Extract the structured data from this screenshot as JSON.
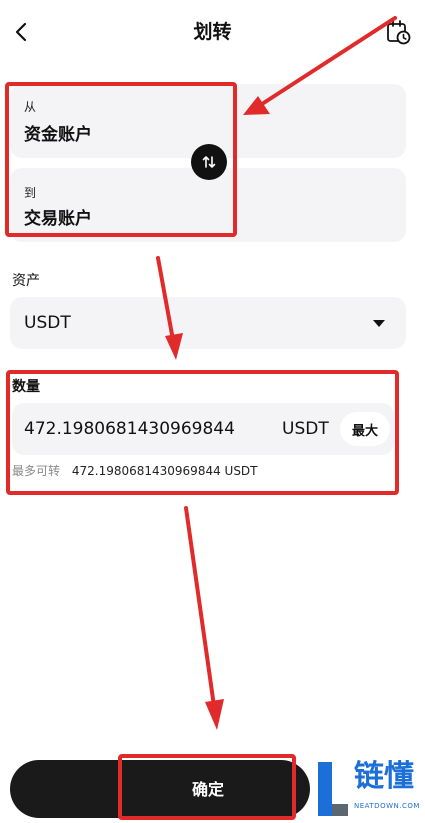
{
  "header": {
    "title": "划转",
    "back_icon": "chevron-left-icon",
    "history_icon": "calendar-clock-icon"
  },
  "from": {
    "label": "从",
    "value": "资金账户"
  },
  "to": {
    "label": "到",
    "value": "交易账户"
  },
  "swap_icon": "swap-arrows-icon",
  "asset": {
    "label": "资产",
    "selected": "USDT"
  },
  "amount": {
    "label": "数量",
    "value": "472.1980681430969844",
    "unit": "USDT",
    "max_label": "最大",
    "available_label": "最多可转",
    "available_value": "472.1980681430969844 USDT"
  },
  "confirm_label": "确定",
  "watermark": {
    "text": "链懂",
    "sub": "NEATDOWN.COM"
  },
  "colors": {
    "accent_red": "#e12a2a",
    "button_dark": "#1a1a1a",
    "watermark_blue": "#1b6fd6"
  }
}
